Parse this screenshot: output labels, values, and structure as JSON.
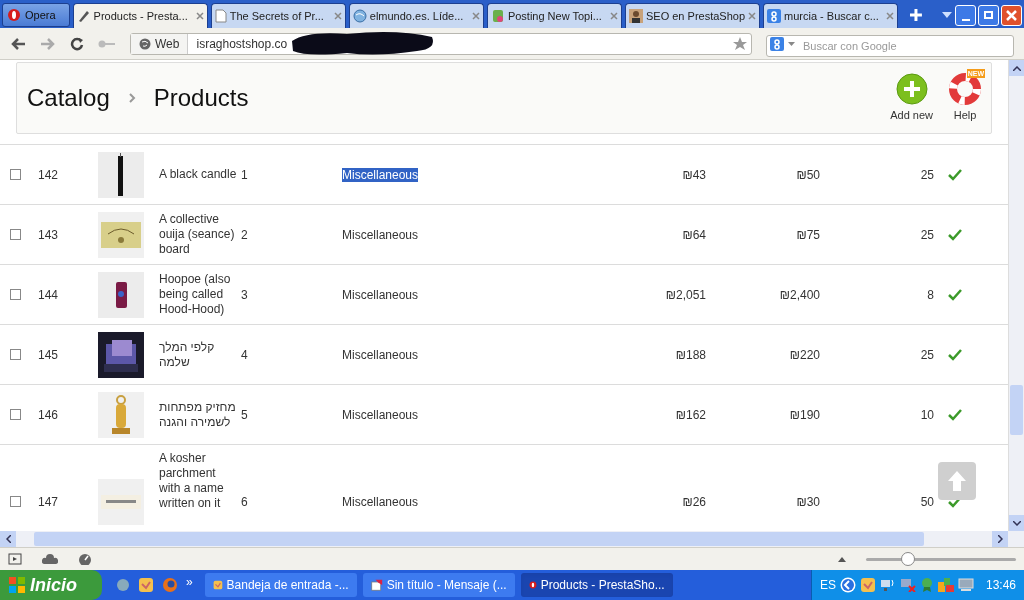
{
  "browser": {
    "menu_button": "Opera",
    "tabs": [
      {
        "title": "Products - Presta...",
        "selected": true
      },
      {
        "title": "The Secrets of Pr...",
        "selected": false
      },
      {
        "title": "elmundo.es. Líde...",
        "selected": false
      },
      {
        "title": "Posting New Topi...",
        "selected": false
      },
      {
        "title": "SEO en PrestaShop",
        "selected": false
      },
      {
        "title": "murcia - Buscar c...",
        "selected": false
      }
    ],
    "address_label": "Web",
    "url": "israghostshop.co",
    "search": {
      "placeholder": "Buscar con Google"
    }
  },
  "page": {
    "breadcrumb": [
      "Catalog",
      "Products"
    ],
    "toolbar": [
      {
        "label": "Add new",
        "kind": "add"
      },
      {
        "label": "Help",
        "kind": "help",
        "badge": "NEW"
      }
    ],
    "rows": [
      {
        "id": "142",
        "name": "A black candle",
        "reference": "1",
        "category": "Miscellaneous",
        "price": "₪43",
        "price_tax": "₪50",
        "quantity": "25",
        "active": true,
        "checked": false,
        "highlighted": true
      },
      {
        "id": "143",
        "name": "A collective ouija (seance) board",
        "reference": "2",
        "category": "Miscellaneous",
        "price": "₪64",
        "price_tax": "₪75",
        "quantity": "25",
        "active": true,
        "checked": false,
        "highlighted": false
      },
      {
        "id": "144",
        "name": "Hoopoe (also being called Hood-Hood)",
        "reference": "3",
        "category": "Miscellaneous",
        "price": "₪2,051",
        "price_tax": "₪2,400",
        "quantity": "8",
        "active": true,
        "checked": false,
        "highlighted": false
      },
      {
        "id": "145",
        "name": "קלפי המלך שלמה",
        "reference": "4",
        "category": "Miscellaneous",
        "price": "₪188",
        "price_tax": "₪220",
        "quantity": "25",
        "active": true,
        "checked": false,
        "highlighted": false
      },
      {
        "id": "146",
        "name": "מחזיק מפתחות לשמירה והגנה",
        "reference": "5",
        "category": "Miscellaneous",
        "price": "₪162",
        "price_tax": "₪190",
        "quantity": "10",
        "active": true,
        "checked": false,
        "highlighted": false
      },
      {
        "id": "147",
        "name": "A kosher parchment with a name written on it",
        "reference": "6",
        "category": "Miscellaneous",
        "price": "₪26",
        "price_tax": "₪30",
        "quantity": "50",
        "active": true,
        "checked": false,
        "highlighted": false
      }
    ]
  },
  "status_bar": {
    "zoom": {
      "level": 0.28
    }
  },
  "taskbar": {
    "start": "Inicio",
    "more": "»",
    "tasks": [
      {
        "title": "Bandeja de entrada -...",
        "selected": false
      },
      {
        "title": "Sin título - Mensaje (...",
        "selected": false
      },
      {
        "title": "Products - PrestaSho...",
        "selected": true
      }
    ],
    "language": "ES",
    "clock": "13:46"
  }
}
